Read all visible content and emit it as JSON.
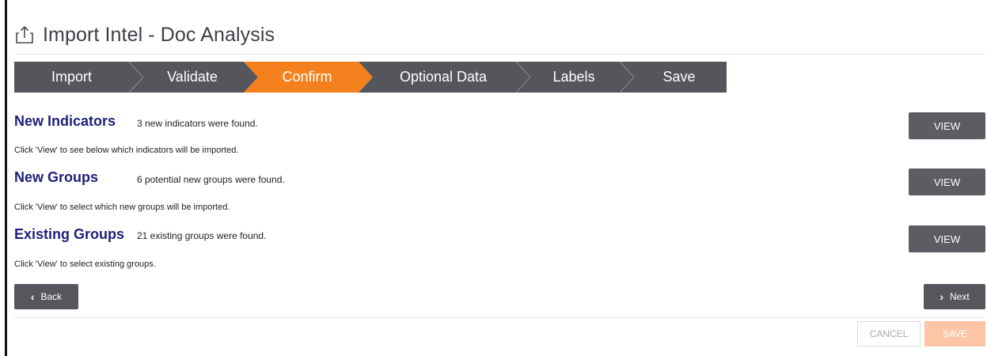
{
  "header": {
    "title": "Import Intel - Doc Analysis",
    "icon": "upload-icon"
  },
  "wizard": {
    "active_color": "#f4801e",
    "inactive_color": "#55555c",
    "steps": [
      {
        "label": "Import",
        "active": false
      },
      {
        "label": "Validate",
        "active": false
      },
      {
        "label": "Confirm",
        "active": true
      },
      {
        "label": "Optional Data",
        "active": false
      },
      {
        "label": "Labels",
        "active": false
      },
      {
        "label": "Save",
        "active": false
      }
    ]
  },
  "sections": [
    {
      "title": "New Indicators",
      "count_text": "3 new indicators were found.",
      "hint": "Click 'View' to see below which indicators will be imported.",
      "button": "VIEW"
    },
    {
      "title": "New Groups",
      "count_text": "6 potential new groups were found.",
      "hint": "Click 'View' to select which new groups will be imported.",
      "button": "VIEW"
    },
    {
      "title": "Existing Groups",
      "count_text": "21 existing groups were found.",
      "hint": "Click 'View' to select existing groups.",
      "button": "VIEW"
    }
  ],
  "navigation": {
    "back_label": "Back",
    "back_icon": "chevron-left-icon",
    "next_label": "Next",
    "next_icon": "chevron-right-icon"
  },
  "footer": {
    "cancel_label": "CANCEL",
    "save_label": "SAVE",
    "save_color": "#fbc5a6"
  }
}
